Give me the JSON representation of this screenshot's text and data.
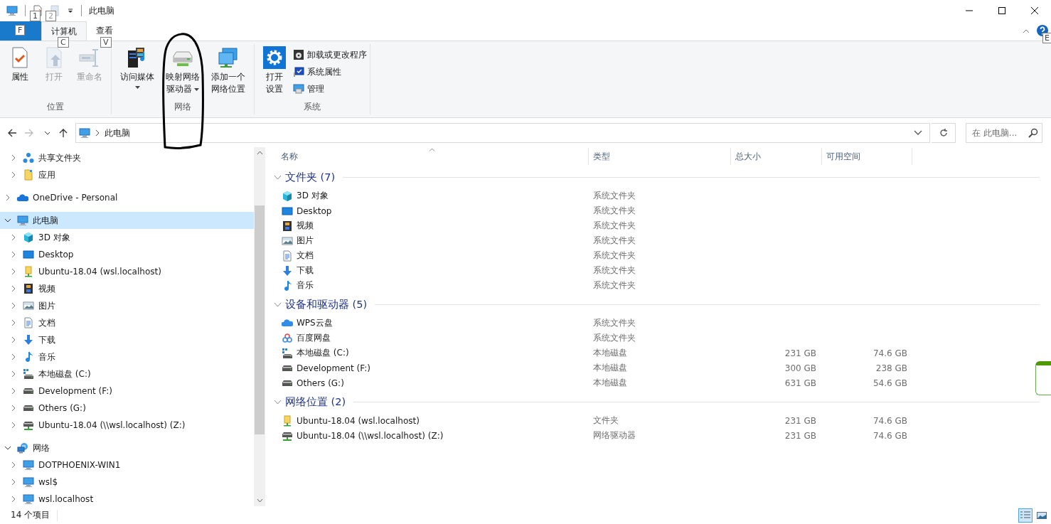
{
  "window": {
    "title": "此电脑"
  },
  "quick_access_toolbar": {
    "keytips": [
      "1",
      "2"
    ]
  },
  "ribbon": {
    "tabs": [
      {
        "kind": "file",
        "keytip": "F",
        "selected": false
      },
      {
        "kind": "tab",
        "label": "计算机",
        "keytip": "C",
        "selected": true
      },
      {
        "kind": "tab",
        "label": "查看",
        "keytip": "V",
        "selected": false
      }
    ],
    "help_keytip": "E",
    "groups": [
      {
        "label": "位置",
        "commands": [
          {
            "kind": "properties",
            "lines": [
              "属性"
            ],
            "disabled": false,
            "dropdown": false
          },
          {
            "kind": "open",
            "lines": [
              "打开"
            ],
            "disabled": true,
            "dropdown": false
          },
          {
            "kind": "rename",
            "lines": [
              "重命名"
            ],
            "disabled": true,
            "dropdown": false
          }
        ]
      },
      {
        "label": "网络",
        "commands": [
          {
            "kind": "media",
            "lines": [
              "访问媒体"
            ],
            "disabled": false,
            "dropdown": true
          },
          {
            "kind": "map-drive",
            "lines": [
              "映射网络",
              "驱动器"
            ],
            "disabled": false,
            "dropdown": true
          },
          {
            "kind": "add-location",
            "lines": [
              "添加一个",
              "网络位置"
            ],
            "disabled": false,
            "dropdown": false
          }
        ]
      },
      {
        "label": "系统",
        "commands": [
          {
            "kind": "settings",
            "lines": [
              "打开",
              "设置"
            ],
            "disabled": false,
            "dropdown": false
          }
        ],
        "small_commands": [
          {
            "kind": "uninstall",
            "label": "卸载或更改程序"
          },
          {
            "kind": "system-properties",
            "label": "系统属性"
          },
          {
            "kind": "manage",
            "label": "管理"
          }
        ]
      }
    ]
  },
  "address_bar": {
    "back_disabled": false,
    "forward_disabled": true,
    "path": [
      {
        "kind": "pc",
        "label": "此电脑"
      }
    ]
  },
  "search": {
    "placeholder": "在 此电脑..."
  },
  "nav_pane": {
    "scrolled_items": [
      {
        "kind": "share",
        "label": "共享文件夹",
        "expanded": false,
        "selected": false
      },
      {
        "kind": "apps",
        "label": "应用",
        "expanded": false,
        "selected": false
      }
    ],
    "tree": [
      {
        "kind": "onedrive",
        "label": "OneDrive - Personal",
        "expanded": false,
        "selected": false
      },
      {
        "kind": "pc",
        "label": "此电脑",
        "expanded": true,
        "selected": true,
        "children": [
          {
            "kind": "objects3d",
            "label": "3D 对象",
            "expanded": false,
            "selected": false
          },
          {
            "kind": "desktop",
            "label": "Desktop",
            "expanded": false,
            "selected": false
          },
          {
            "kind": "net-folder",
            "label": "Ubuntu-18.04 (wsl.localhost)",
            "expanded": false,
            "selected": false
          },
          {
            "kind": "videos",
            "label": "视频",
            "expanded": false,
            "selected": false
          },
          {
            "kind": "pictures",
            "label": "图片",
            "expanded": false,
            "selected": false
          },
          {
            "kind": "documents",
            "label": "文档",
            "expanded": false,
            "selected": false
          },
          {
            "kind": "downloads",
            "label": "下载",
            "expanded": false,
            "selected": false
          },
          {
            "kind": "music",
            "label": "音乐",
            "expanded": false,
            "selected": false
          },
          {
            "kind": "os-drive",
            "label": "本地磁盘 (C:)",
            "expanded": false,
            "selected": false
          },
          {
            "kind": "drive",
            "label": "Development (F:)",
            "expanded": false,
            "selected": false
          },
          {
            "kind": "drive",
            "label": "Others (G:)",
            "expanded": false,
            "selected": false
          },
          {
            "kind": "net-drive",
            "label": "Ubuntu-18.04 (\\\\wsl.localhost) (Z:)",
            "expanded": false,
            "selected": false
          }
        ]
      },
      {
        "kind": "network",
        "label": "网络",
        "expanded": true,
        "selected": false,
        "children": [
          {
            "kind": "pc",
            "label": "DOTPHOENIX-WIN1",
            "expanded": false,
            "selected": false
          },
          {
            "kind": "pc",
            "label": "wsl$",
            "expanded": false,
            "selected": false
          },
          {
            "kind": "pc",
            "label": "wsl.localhost",
            "expanded": false,
            "selected": false
          }
        ]
      }
    ]
  },
  "content": {
    "columns": [
      {
        "label": "名称",
        "sorted": true
      },
      {
        "label": "类型",
        "sorted": false
      },
      {
        "label": "总大小",
        "sorted": false
      },
      {
        "label": "可用空间",
        "sorted": false
      }
    ],
    "groups": [
      {
        "title": "文件夹 (7)",
        "expanded": true,
        "rows": [
          {
            "kind": "objects3d",
            "name": "3D 对象",
            "type": "系统文件夹"
          },
          {
            "kind": "desktop",
            "name": "Desktop",
            "type": "系统文件夹"
          },
          {
            "kind": "videos",
            "name": "视频",
            "type": "系统文件夹"
          },
          {
            "kind": "pictures",
            "name": "图片",
            "type": "系统文件夹"
          },
          {
            "kind": "documents",
            "name": "文档",
            "type": "系统文件夹"
          },
          {
            "kind": "downloads",
            "name": "下载",
            "type": "系统文件夹"
          },
          {
            "kind": "music",
            "name": "音乐",
            "type": "系统文件夹"
          }
        ]
      },
      {
        "title": "设备和驱动器 (5)",
        "expanded": true,
        "rows": [
          {
            "kind": "wps",
            "name": "WPS云盘",
            "type": "系统文件夹"
          },
          {
            "kind": "baidu",
            "name": "百度网盘",
            "type": "系统文件夹"
          },
          {
            "kind": "os-drive",
            "name": "本地磁盘 (C:)",
            "type": "本地磁盘",
            "total": "231 GB",
            "free": "74.6 GB"
          },
          {
            "kind": "drive",
            "name": "Development (F:)",
            "type": "本地磁盘",
            "total": "300 GB",
            "free": "238 GB"
          },
          {
            "kind": "drive",
            "name": "Others (G:)",
            "type": "本地磁盘",
            "total": "631 GB",
            "free": "54.6 GB"
          }
        ]
      },
      {
        "title": "网络位置 (2)",
        "expanded": true,
        "rows": [
          {
            "kind": "net-folder",
            "name": "Ubuntu-18.04 (wsl.localhost)",
            "type": "文件夹",
            "total": "231 GB",
            "free": "74.6 GB"
          },
          {
            "kind": "net-drive",
            "name": "Ubuntu-18.04 (\\\\wsl.localhost) (Z:)",
            "type": "网络驱动器",
            "total": "231 GB",
            "free": "74.6 GB"
          }
        ]
      }
    ]
  },
  "status_bar": {
    "item_count": "14 个项目",
    "views": [
      {
        "kind": "details",
        "selected": true
      },
      {
        "kind": "large-icons",
        "selected": false
      }
    ]
  }
}
